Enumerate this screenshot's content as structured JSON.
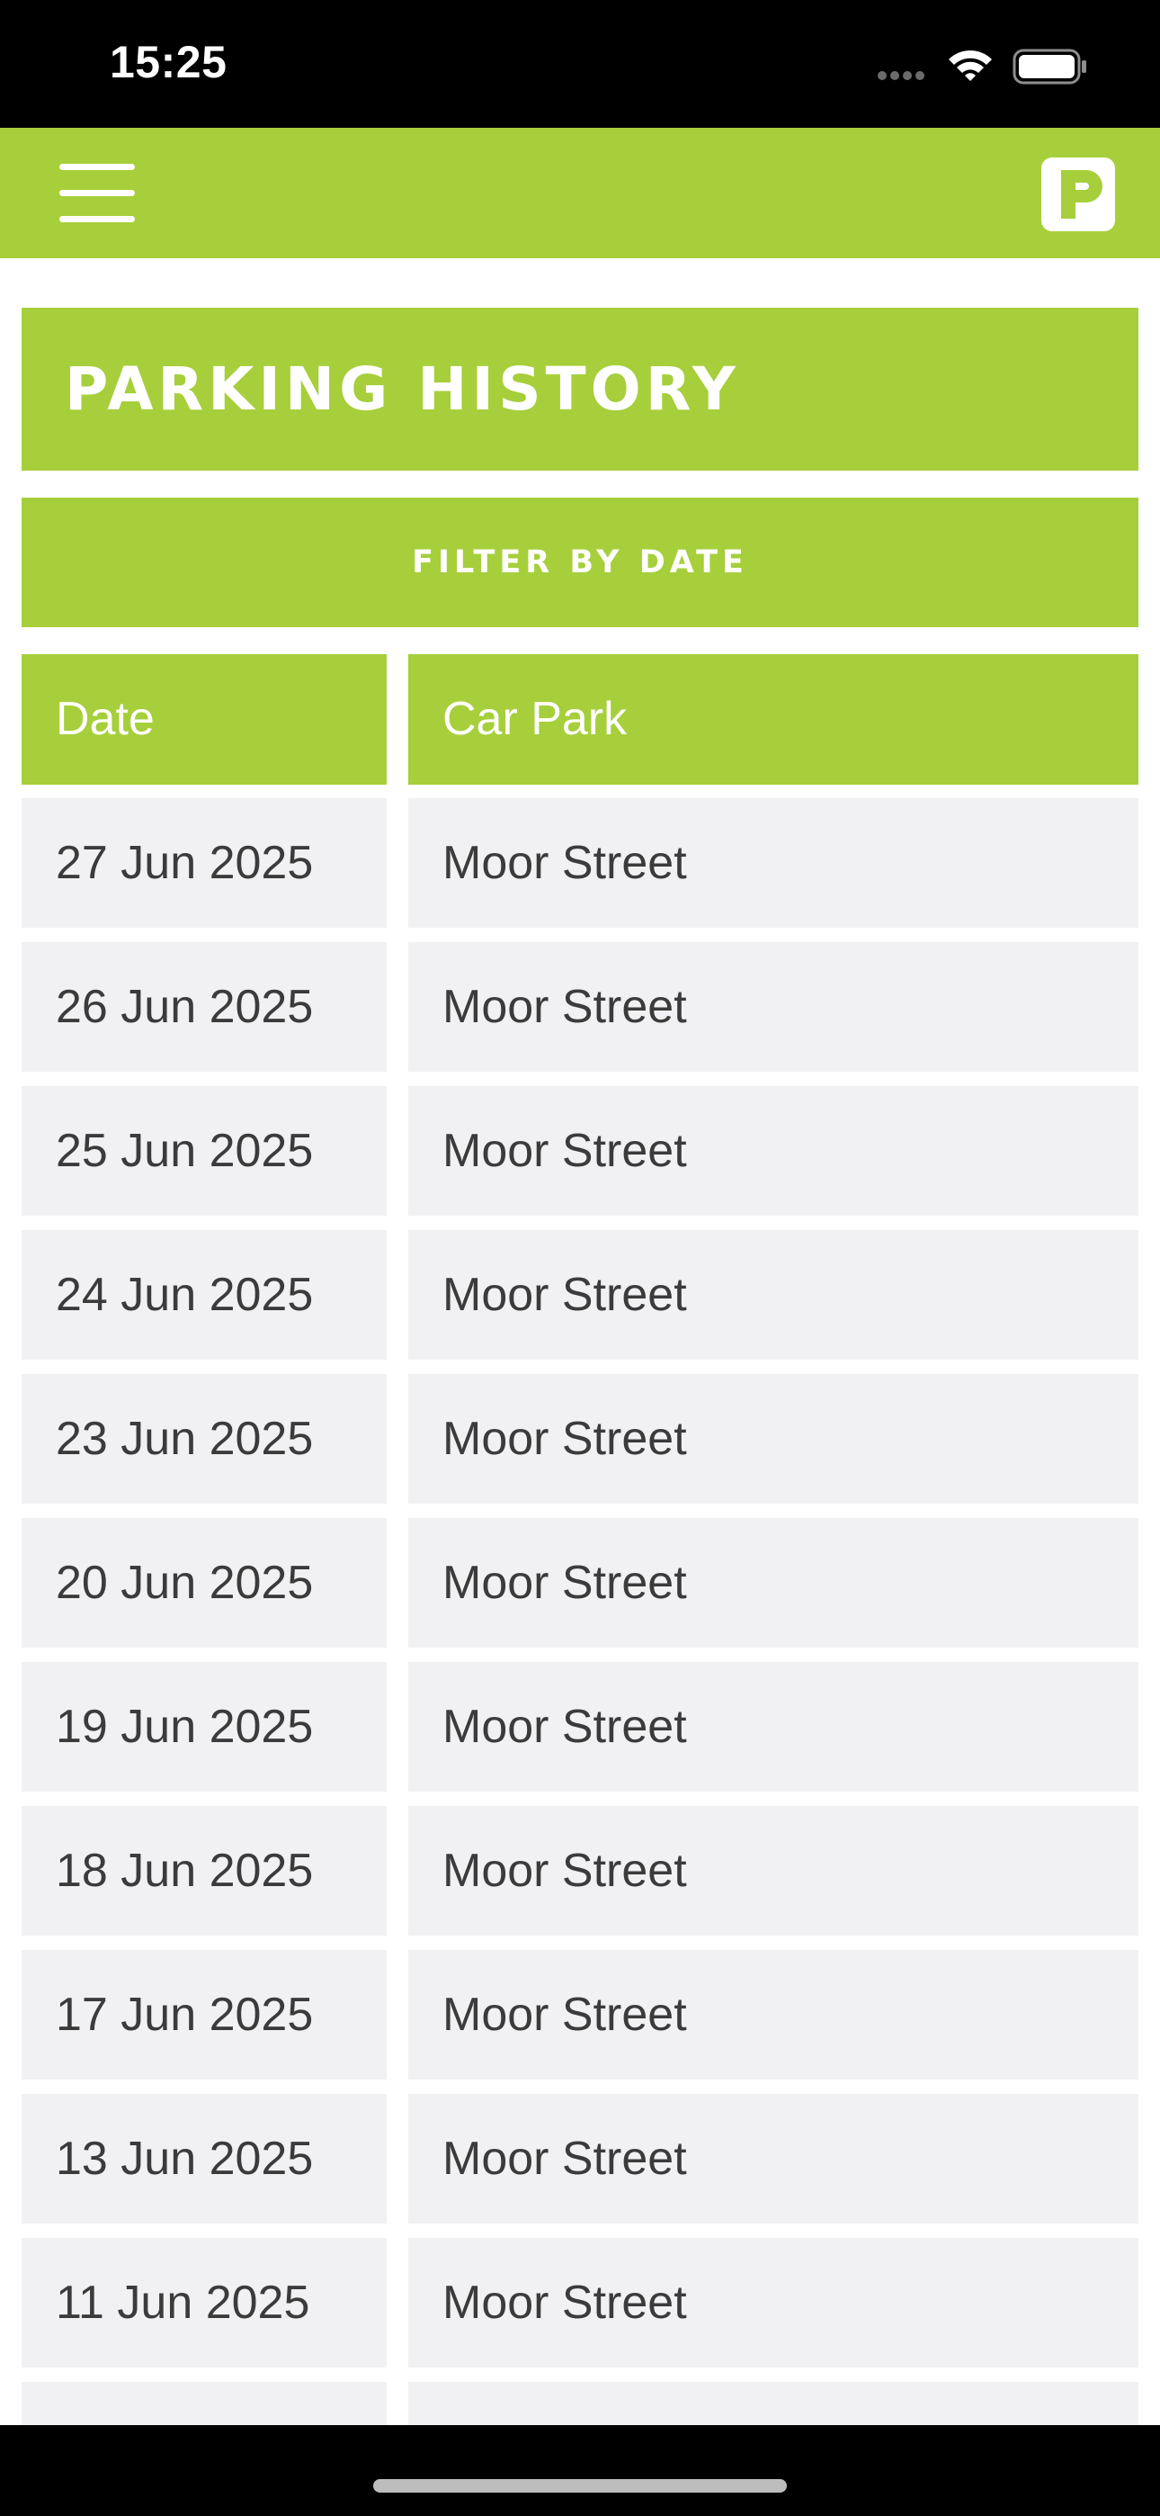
{
  "status_bar": {
    "time": "15:25",
    "icons": [
      "cell-signal-icon",
      "wifi-icon",
      "battery-icon"
    ]
  },
  "header": {
    "menu_icon": "hamburger-menu-icon",
    "logo_icon": "parking-p-logo-icon"
  },
  "page": {
    "title": "PARKING HISTORY",
    "filter_label": "FILTER BY DATE"
  },
  "table": {
    "columns": [
      "Date",
      "Car Park"
    ],
    "rows": [
      [
        "27 Jun 2025",
        "Moor Street"
      ],
      [
        "26 Jun 2025",
        "Moor Street"
      ],
      [
        "25 Jun 2025",
        "Moor Street"
      ],
      [
        "24 Jun 2025",
        "Moor Street"
      ],
      [
        "23 Jun 2025",
        "Moor Street"
      ],
      [
        "20 Jun 2025",
        "Moor Street"
      ],
      [
        "19 Jun 2025",
        "Moor Street"
      ],
      [
        "18 Jun 2025",
        "Moor Street"
      ],
      [
        "17 Jun 2025",
        "Moor Street"
      ],
      [
        "13 Jun 2025",
        "Moor Street"
      ],
      [
        "11 Jun 2025",
        "Moor Street"
      ],
      [
        "",
        ""
      ]
    ]
  },
  "colors": {
    "accent": "#a6cf3b",
    "row_background": "#f1f1f3",
    "text": "#3b3b3b"
  }
}
